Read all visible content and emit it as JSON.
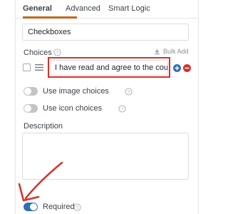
{
  "tabs": [
    {
      "label": "General",
      "active": true
    },
    {
      "label": "Advanced",
      "active": false
    },
    {
      "label": "Smart Logic",
      "active": false
    }
  ],
  "field_title": {
    "value": "Checkboxes"
  },
  "choices": {
    "label": "Choices",
    "bulk_add_label": "Bulk Add",
    "items": [
      {
        "value": "I have read and agree to the coupo",
        "checked": false
      }
    ]
  },
  "options": {
    "image_choices": {
      "label": "Use image choices",
      "enabled": false
    },
    "icon_choices": {
      "label": "Use icon choices",
      "enabled": false
    }
  },
  "description": {
    "label": "Description",
    "value": ""
  },
  "required": {
    "label": "Required",
    "enabled": true
  },
  "colors": {
    "accent": "#c06a20",
    "toggle_on": "#2f6fb5",
    "highlight": "#d6322a",
    "annotation_arrow": "#d6322a"
  },
  "icons": {
    "help": "question-circle-icon",
    "bulk_add": "download-icon",
    "drag": "drag-handle-icon",
    "add": "plus-circle-icon",
    "remove": "minus-circle-icon"
  }
}
